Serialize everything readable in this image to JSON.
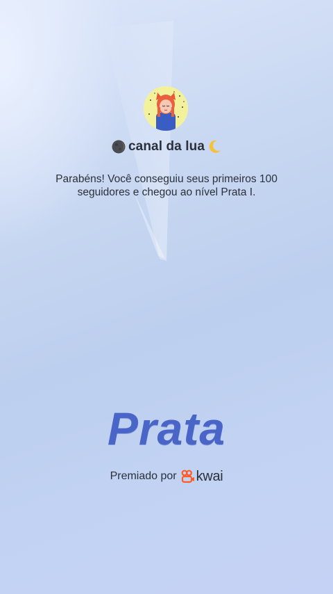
{
  "channel": {
    "name": "canal da lua",
    "leading_icon": "new-moon-icon",
    "trailing_icon": "crescent-moon-icon"
  },
  "message": "Parabéns! Você conseguiu seus primeiros 100 seguidores e chegou ao nível Prata I.",
  "level": {
    "title": "Prata"
  },
  "awarded": {
    "label": "Premiado por",
    "brand": "kwai",
    "brand_icon": "kwai-logo-icon"
  },
  "colors": {
    "background": "#c9d8f2",
    "level_title": "#4a65c8",
    "kwai_orange": "#ff5b23",
    "text": "#2b2f3a"
  }
}
